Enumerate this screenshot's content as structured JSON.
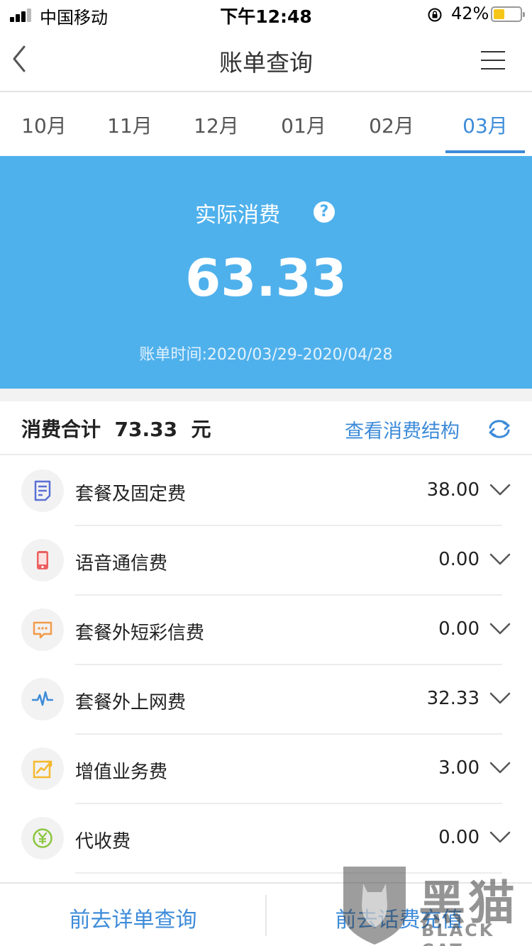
{
  "status_bar": {
    "carrier": "中国移动",
    "time": "下午12:48",
    "battery_percent": "42%",
    "battery_level": 0.42
  },
  "nav": {
    "title": "账单查询",
    "back_icon": "chevron-left-icon",
    "menu_icon": "hamburger-menu-icon"
  },
  "tabs": [
    {
      "label": "10月",
      "active": false
    },
    {
      "label": "11月",
      "active": false
    },
    {
      "label": "12月",
      "active": false
    },
    {
      "label": "01月",
      "active": false
    },
    {
      "label": "02月",
      "active": false
    },
    {
      "label": "03月",
      "active": true
    }
  ],
  "summary": {
    "label": "实际消费",
    "help_icon": "?",
    "amount": "63.33",
    "period": "账单时间:2020/03/29-2020/04/28"
  },
  "totals": {
    "text": "消费合计  73.33  元",
    "structure_link": "查看消费结构",
    "refresh_icon": "refresh-icon"
  },
  "fees": [
    {
      "label": "套餐及固定费",
      "amount": "38.00",
      "icon": "document-icon",
      "color": "#5b6fd6"
    },
    {
      "label": "语音通信费",
      "amount": "0.00",
      "icon": "phone-icon",
      "color": "#ec5f5f"
    },
    {
      "label": "套餐外短彩信费",
      "amount": "0.00",
      "icon": "message-icon",
      "color": "#f29b4a"
    },
    {
      "label": "套餐外上网费",
      "amount": "32.33",
      "icon": "pulse-icon",
      "color": "#3d8bd9"
    },
    {
      "label": "增值业务费",
      "amount": "3.00",
      "icon": "chart-growth-icon",
      "color": "#f5b82e"
    },
    {
      "label": "代收费",
      "amount": "0.00",
      "icon": "yuan-icon",
      "color": "#8cc63f"
    }
  ],
  "bottom": {
    "detail_button": "前去详单查询",
    "recharge_button": "前去话费充值"
  },
  "watermark": {
    "text": "黑猫",
    "sub": "BLACK CAT"
  },
  "colors": {
    "accent": "#3d8bd9",
    "banner": "#4fb1ec"
  }
}
